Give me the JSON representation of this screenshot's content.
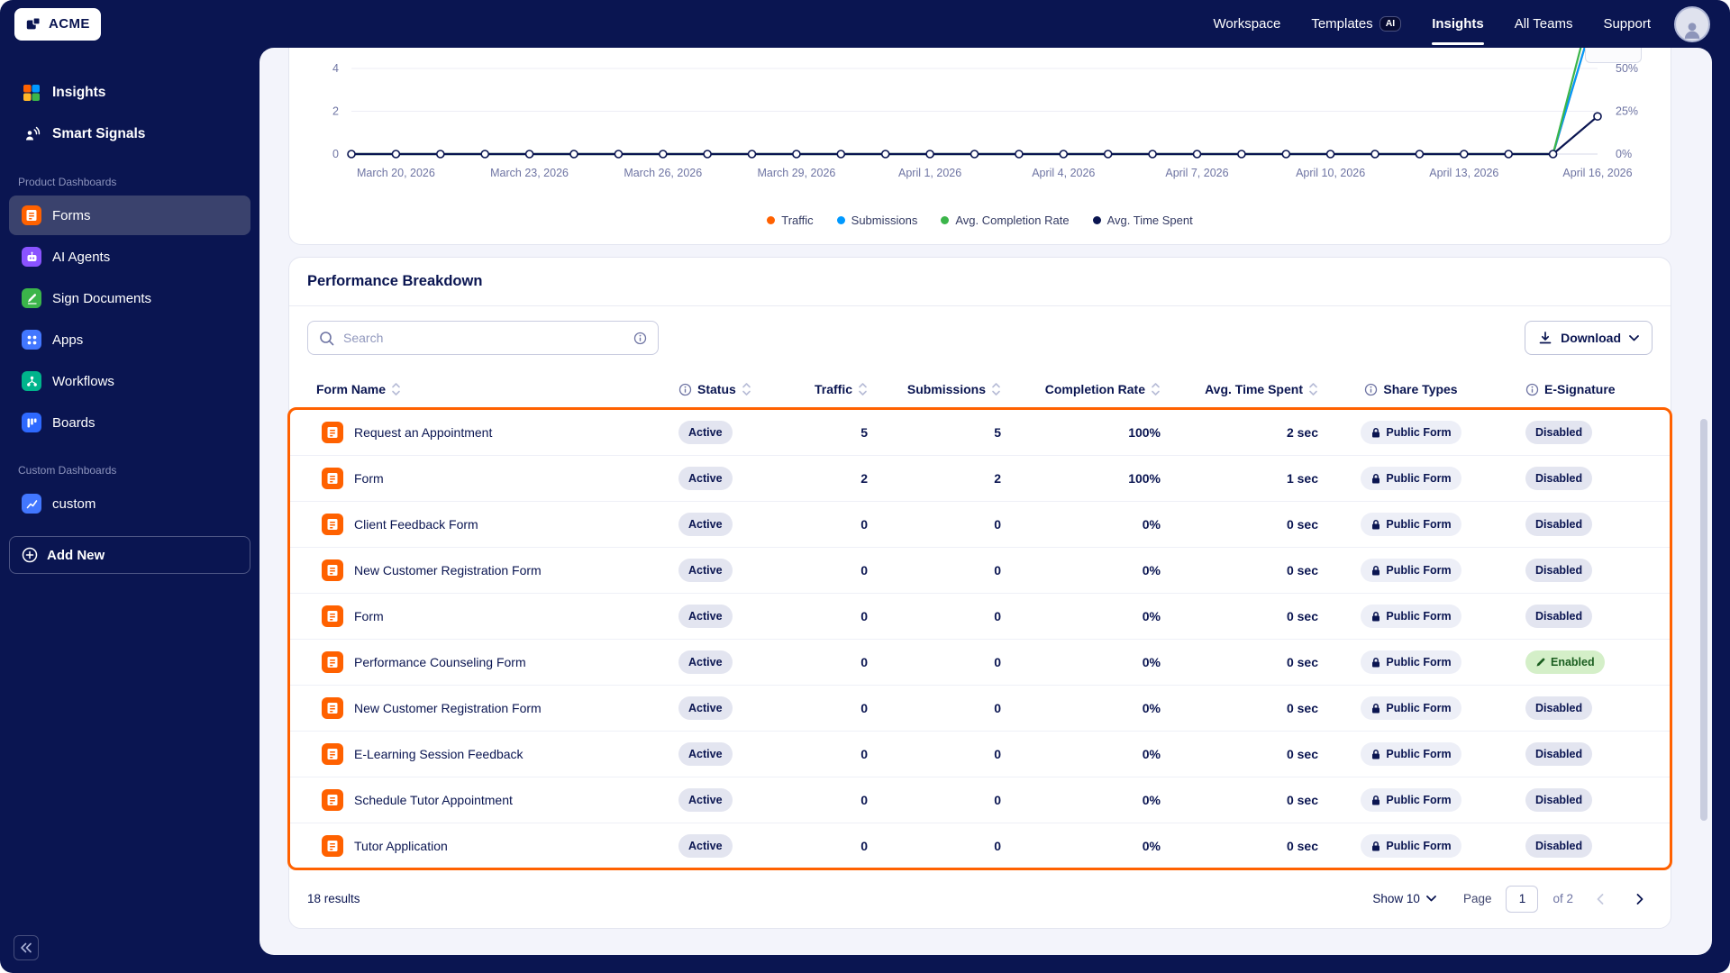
{
  "colors": {
    "navy": "#0a1551",
    "orange": "#ff6100",
    "highlight": "#ff6100",
    "panel_bg": "#f3f4fb"
  },
  "topnav": {
    "logo_text": "ACME",
    "items": [
      {
        "label": "Workspace",
        "active": false
      },
      {
        "label": "Templates",
        "badge": "AI",
        "active": false
      },
      {
        "label": "Insights",
        "active": true
      },
      {
        "label": "All Teams",
        "active": false
      },
      {
        "label": "Support",
        "active": false
      }
    ]
  },
  "sidebar": {
    "primary_items": [
      {
        "label": "Insights",
        "icon": "insights-icon"
      },
      {
        "label": "Smart Signals",
        "icon": "smart-signals-icon"
      }
    ],
    "sections": [
      {
        "title": "Product Dashboards",
        "items": [
          {
            "label": "Forms",
            "icon": "forms-icon",
            "color": "#ff6100",
            "active": true
          },
          {
            "label": "AI Agents",
            "icon": "ai-agents-icon",
            "color": "#8a53ff",
            "active": false
          },
          {
            "label": "Sign Documents",
            "icon": "sign-documents-icon",
            "color": "#3bb54a",
            "active": false
          },
          {
            "label": "Apps",
            "icon": "apps-icon",
            "color": "#4277ff",
            "active": false
          },
          {
            "label": "Workflows",
            "icon": "workflows-icon",
            "color": "#00b48c",
            "active": false
          },
          {
            "label": "Boards",
            "icon": "boards-icon",
            "color": "#2e69ff",
            "active": false
          }
        ]
      },
      {
        "title": "Custom Dashboards",
        "items": [
          {
            "label": "custom",
            "icon": "custom-dashboard-icon",
            "color": "#4277ff",
            "active": false
          }
        ]
      }
    ],
    "add_new": "Add New"
  },
  "chart_data": {
    "type": "line",
    "title": "",
    "num_points": 29,
    "tick_start_index": 1,
    "tick_every": 3,
    "x_tick_labels": [
      "March 20, 2026",
      "March 23, 2026",
      "March 26, 2026",
      "March 29, 2026",
      "April 1, 2026",
      "April 4, 2026",
      "April 7, 2026",
      "April 10, 2026",
      "April 13, 2026",
      "April 16, 2026"
    ],
    "left_axis": {
      "ticks_visible": [
        0,
        2,
        4
      ],
      "units_per_grid": 2
    },
    "right_axis": {
      "ticks_visible": [
        "0%",
        "25%",
        "50%"
      ],
      "percent_per_grid": 25
    },
    "grid": true,
    "legend_position": "bottom",
    "series": [
      {
        "name": "Traffic",
        "color": "#ff6100",
        "axis": "left",
        "values": [
          0,
          0,
          0,
          0,
          0,
          0,
          0,
          0,
          0,
          0,
          0,
          0,
          0,
          0,
          0,
          0,
          0,
          0,
          0,
          0,
          0,
          0,
          0,
          0,
          0,
          0,
          0,
          0,
          7
        ]
      },
      {
        "name": "Submissions",
        "color": "#0099ff",
        "axis": "left",
        "values": [
          0,
          0,
          0,
          0,
          0,
          0,
          0,
          0,
          0,
          0,
          0,
          0,
          0,
          0,
          0,
          0,
          0,
          0,
          0,
          0,
          0,
          0,
          0,
          0,
          0,
          0,
          0,
          0,
          7
        ]
      },
      {
        "name": "Avg. Completion Rate",
        "color": "#3bb54a",
        "axis": "right",
        "values": [
          0,
          0,
          0,
          0,
          0,
          0,
          0,
          0,
          0,
          0,
          0,
          0,
          0,
          0,
          0,
          0,
          0,
          0,
          0,
          0,
          0,
          0,
          0,
          0,
          0,
          0,
          0,
          0,
          100
        ]
      },
      {
        "name": "Avg. Time Spent",
        "color": "#0a1551",
        "axis": "right",
        "markers": true,
        "values": [
          0,
          0,
          0,
          0,
          0,
          0,
          0,
          0,
          0,
          0,
          0,
          0,
          0,
          0,
          0,
          0,
          0,
          0,
          0,
          0,
          0,
          0,
          0,
          0,
          0,
          0,
          0,
          0,
          22
        ]
      }
    ]
  },
  "breakdown": {
    "title": "Performance Breakdown",
    "search": {
      "placeholder": "Search"
    },
    "download": {
      "label": "Download"
    },
    "columns": [
      {
        "key": "form_name",
        "label": "Form Name",
        "sortable": true,
        "info": false,
        "align": "left"
      },
      {
        "key": "status",
        "label": "Status",
        "sortable": true,
        "info": true,
        "align": "left"
      },
      {
        "key": "traffic",
        "label": "Traffic",
        "sortable": true,
        "info": false,
        "align": "right"
      },
      {
        "key": "submissions",
        "label": "Submissions",
        "sortable": true,
        "info": false,
        "align": "right"
      },
      {
        "key": "completion_rate",
        "label": "Completion Rate",
        "sortable": true,
        "info": false,
        "align": "right"
      },
      {
        "key": "avg_time_spent",
        "label": "Avg. Time Spent",
        "sortable": true,
        "info": false,
        "align": "right"
      },
      {
        "key": "share_types",
        "label": "Share Types",
        "sortable": false,
        "info": true,
        "align": "center"
      },
      {
        "key": "e_signature",
        "label": "E-Signature",
        "sortable": false,
        "info": true,
        "align": "left"
      }
    ],
    "rows": [
      {
        "form_name": "Request an Appointment",
        "status": "Active",
        "traffic": "5",
        "submissions": "5",
        "completion_rate": "100%",
        "avg_time_spent": "2 sec",
        "share_types": "Public Form",
        "e_signature": "Disabled"
      },
      {
        "form_name": "Form",
        "status": "Active",
        "traffic": "2",
        "submissions": "2",
        "completion_rate": "100%",
        "avg_time_spent": "1 sec",
        "share_types": "Public Form",
        "e_signature": "Disabled"
      },
      {
        "form_name": "Client Feedback Form",
        "status": "Active",
        "traffic": "0",
        "submissions": "0",
        "completion_rate": "0%",
        "avg_time_spent": "0 sec",
        "share_types": "Public Form",
        "e_signature": "Disabled"
      },
      {
        "form_name": "New Customer Registration Form",
        "status": "Active",
        "traffic": "0",
        "submissions": "0",
        "completion_rate": "0%",
        "avg_time_spent": "0 sec",
        "share_types": "Public Form",
        "e_signature": "Disabled"
      },
      {
        "form_name": "Form",
        "status": "Active",
        "traffic": "0",
        "submissions": "0",
        "completion_rate": "0%",
        "avg_time_spent": "0 sec",
        "share_types": "Public Form",
        "e_signature": "Disabled"
      },
      {
        "form_name": "Performance Counseling Form",
        "status": "Active",
        "traffic": "0",
        "submissions": "0",
        "completion_rate": "0%",
        "avg_time_spent": "0 sec",
        "share_types": "Public Form",
        "e_signature": "Enabled"
      },
      {
        "form_name": "New Customer Registration Form",
        "status": "Active",
        "traffic": "0",
        "submissions": "0",
        "completion_rate": "0%",
        "avg_time_spent": "0 sec",
        "share_types": "Public Form",
        "e_signature": "Disabled"
      },
      {
        "form_name": "E-Learning Session Feedback",
        "status": "Active",
        "traffic": "0",
        "submissions": "0",
        "completion_rate": "0%",
        "avg_time_spent": "0 sec",
        "share_types": "Public Form",
        "e_signature": "Disabled"
      },
      {
        "form_name": "Schedule Tutor Appointment",
        "status": "Active",
        "traffic": "0",
        "submissions": "0",
        "completion_rate": "0%",
        "avg_time_spent": "0 sec",
        "share_types": "Public Form",
        "e_signature": "Disabled"
      },
      {
        "form_name": "Tutor Application",
        "status": "Active",
        "traffic": "0",
        "submissions": "0",
        "completion_rate": "0%",
        "avg_time_spent": "0 sec",
        "share_types": "Public Form",
        "e_signature": "Disabled"
      }
    ],
    "footer": {
      "results": "18 results",
      "show": "Show 10",
      "page_label": "Page",
      "page_value": "1",
      "of_label": "of 2"
    }
  }
}
